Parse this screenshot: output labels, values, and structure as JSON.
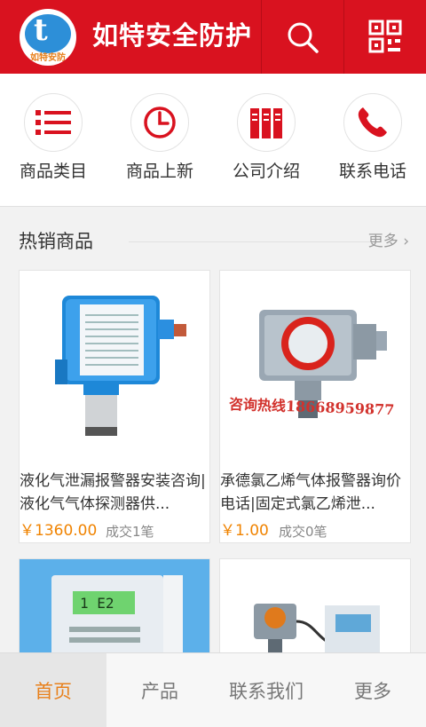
{
  "header": {
    "logo_letter": "t",
    "logo_text": "如特安防",
    "title": "如特安全防护",
    "icons": [
      "search-icon",
      "qrcode-icon"
    ]
  },
  "quicknav": [
    {
      "label": "商品类目",
      "icon": "list-icon"
    },
    {
      "label": "商品上新",
      "icon": "clock-icon"
    },
    {
      "label": "公司介绍",
      "icon": "building-icon"
    },
    {
      "label": "联系电话",
      "icon": "phone-icon"
    }
  ],
  "hot": {
    "title": "热销商品",
    "more": "更多 ›",
    "products": [
      {
        "name": "液化气泄漏报警器安装咨询|液化气气体探测器供...",
        "price": "￥1360.00",
        "sold": "成交1笔"
      },
      {
        "name": "承德氯乙烯气体报警器询价电话|固定式氯乙烯泄...",
        "price": "￥1.00",
        "sold": "成交0笔",
        "watermark": "咨询热线18668959877"
      },
      {
        "name": "",
        "price": "",
        "sold": "",
        "panel_text": "1 E2"
      },
      {
        "name": "",
        "price": "",
        "sold": ""
      }
    ]
  },
  "tabbar": [
    {
      "label": "首页",
      "active": true
    },
    {
      "label": "产品",
      "active": false
    },
    {
      "label": "联系我们",
      "active": false
    },
    {
      "label": "更多",
      "active": false
    }
  ],
  "colors": {
    "brand": "#d9121f",
    "accent": "#e8801c",
    "price": "#f08300"
  }
}
